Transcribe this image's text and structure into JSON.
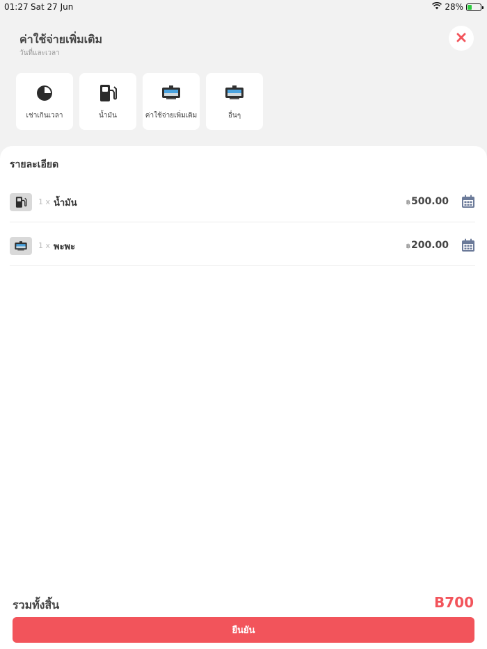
{
  "status": {
    "time": "01:27",
    "date": "Sat 27 Jun",
    "battery": "28%",
    "battery_level": 0.28
  },
  "header": {
    "title": "ค่าใช้จ่ายเพิ่มเติม",
    "subtitle": "วันที่และเวลา",
    "close_icon": "close-icon"
  },
  "categories": [
    {
      "label": "เช่าเกินเวลา",
      "icon": "clock-icon"
    },
    {
      "label": "น้ำมัน",
      "icon": "fuel-pump-icon"
    },
    {
      "label": "ค่าใช้จ่ายเพิ่มเติม",
      "icon": "dashcam-icon"
    },
    {
      "label": "อื่นๆ",
      "icon": "dashcam-icon"
    }
  ],
  "details": {
    "title": "รายละเอียด",
    "items": [
      {
        "qty": "1 x",
        "name": "น้ำมัน",
        "currency": "฿",
        "amount": "500.00",
        "icon": "fuel-pump-icon"
      },
      {
        "qty": "1 x",
        "name": "พะพะ",
        "currency": "฿",
        "amount": "200.00",
        "icon": "dashcam-icon"
      }
    ]
  },
  "footer": {
    "total_label": "รวมทั้งสิ้น",
    "total_value": "B700",
    "confirm_label": "ยืนยัน"
  },
  "colors": {
    "accent": "#f2545b",
    "background": "#f2f2f2",
    "calendar": "#6b7a99"
  }
}
